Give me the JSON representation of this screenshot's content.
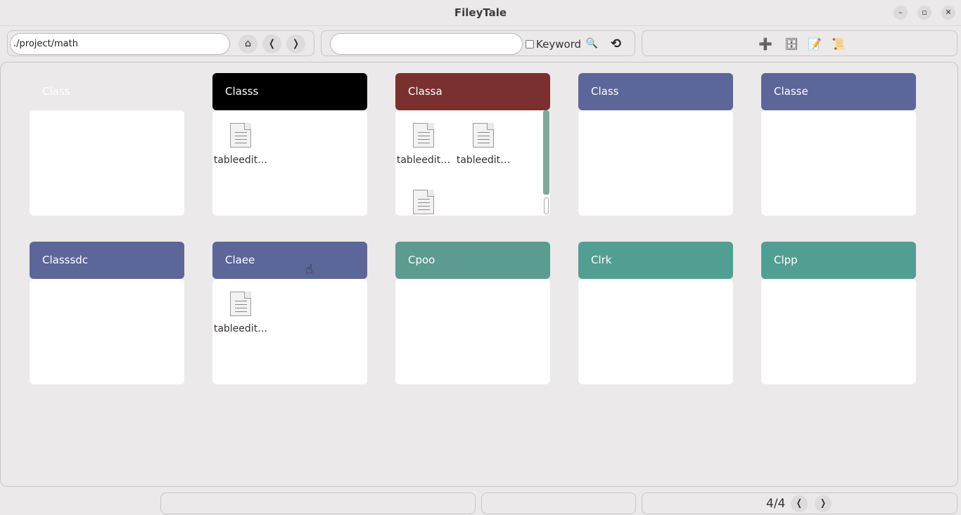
{
  "window": {
    "title": "FileyTale",
    "minimize": "–",
    "restore": "▫",
    "close": "✕"
  },
  "toolbar": {
    "path_value": "./project/math",
    "home_icon": "⌂",
    "back_icon": "❬",
    "forward_icon": "❭",
    "search_value": "",
    "keyword_label": "Keyword",
    "keyword_checked": false,
    "search_icon": "🔍",
    "refresh_icon": "⟲",
    "add_icon": "➕",
    "cabinet_icon": "🗄",
    "memo_icon": "📝",
    "scroll_icon": "📜"
  },
  "cards": [
    {
      "title": "Class",
      "color": "#ebe9e9",
      "files": []
    },
    {
      "title": "Classs",
      "color": "#000000",
      "files": [
        "tableedit…"
      ]
    },
    {
      "title": "Classa",
      "color": "#7b3030",
      "files": [
        "tableedit…",
        "tableedit…",
        ""
      ]
    },
    {
      "title": "Class",
      "color": "#5d6699",
      "files": []
    },
    {
      "title": "Classe",
      "color": "#5d6699",
      "files": []
    },
    {
      "title": "Classsdc",
      "color": "#5d6699",
      "files": []
    },
    {
      "title": "Claee",
      "color": "#5d6699",
      "files": [
        "tableedit…"
      ]
    },
    {
      "title": "Cpoo",
      "color": "#5c9b90",
      "files": []
    },
    {
      "title": "Clrk",
      "color": "#539e92",
      "files": []
    },
    {
      "title": "Clpp",
      "color": "#539e92",
      "files": []
    }
  ],
  "statusbar": {
    "page_indicator": "4/4",
    "prev_icon": "❬",
    "next_icon": "❭"
  }
}
